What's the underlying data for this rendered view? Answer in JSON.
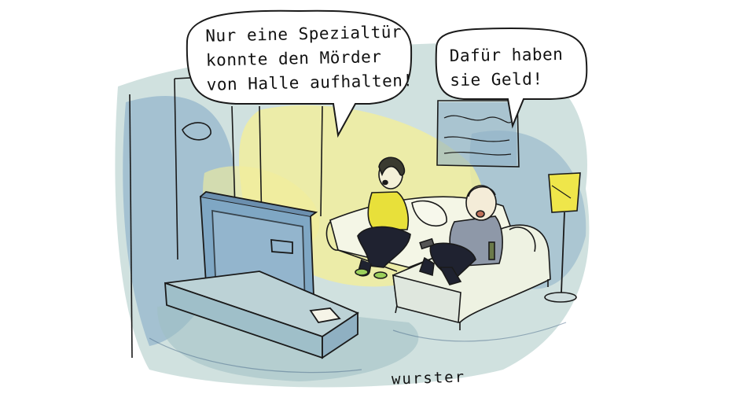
{
  "speech": {
    "woman_lines": [
      "Nur eine Spezialtür",
      "konnte den Mörder",
      "von Halle aufhalten!"
    ],
    "man_lines": [
      "Dafür haben",
      "sie Geld!"
    ]
  },
  "signature": "wurster",
  "colors": {
    "wash_blue": "#7fa7c4",
    "wash_teal": "#a9c9c5",
    "wash_yellow": "#f3ef9a",
    "shirt_yellow": "#e8e03a",
    "lamp_yellow": "#efe64a",
    "ink": "#1a1a1a"
  }
}
